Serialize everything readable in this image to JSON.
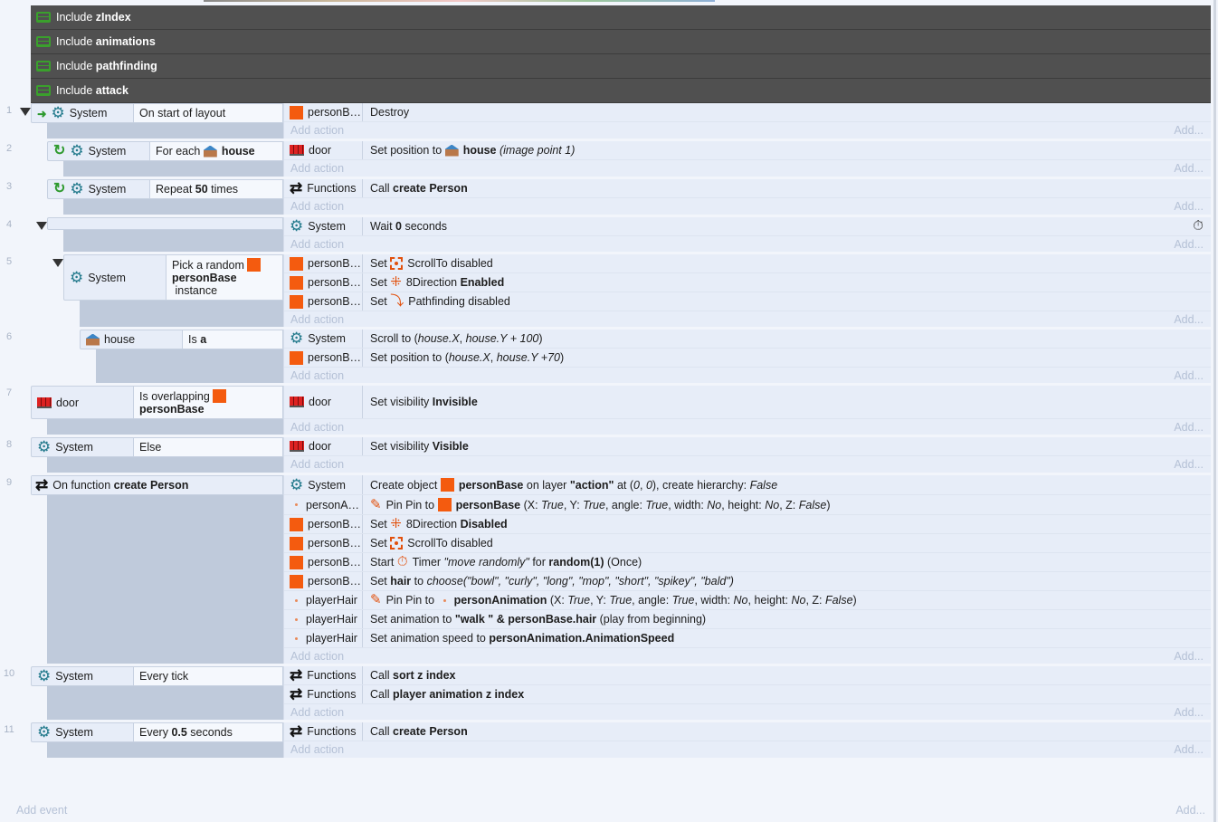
{
  "includes": [
    {
      "prefix": "Include ",
      "name": "zIndex"
    },
    {
      "prefix": "Include ",
      "name": "animations"
    },
    {
      "prefix": "Include ",
      "name": "pathfinding"
    },
    {
      "prefix": "Include ",
      "name": "attack"
    }
  ],
  "labels": {
    "add_action": "Add action",
    "add_more": "Add...",
    "add_event": "Add event"
  },
  "colors": {
    "object_orange": "#f45b0f",
    "system_teal": "#237a8c",
    "include_bg": "#505050",
    "event_bg": "#e7edf8",
    "filler": "#bfcadb"
  },
  "events": [
    {
      "num": "1",
      "indent": 0,
      "collapse": true,
      "conds": [
        {
          "pre": "arrow-icon",
          "icon": "gear-icon",
          "obj": "System",
          "text": [
            {
              "t": "On start of layout"
            }
          ]
        }
      ],
      "actions": [
        {
          "icon": "square-icon",
          "obj": "personB…",
          "text": [
            {
              "t": "Destroy"
            }
          ]
        }
      ]
    },
    {
      "num": "2",
      "indent": 1,
      "conds": [
        {
          "pre": "loop-icon",
          "icon": "gear-icon",
          "obj": "System",
          "text": [
            {
              "t": "For each "
            },
            {
              "icon": "house-icon"
            },
            {
              "t": "house",
              "b": true
            }
          ]
        }
      ],
      "actions": [
        {
          "icon": "door-icon",
          "obj": "door",
          "text": [
            {
              "t": "Set position to "
            },
            {
              "icon": "house-icon"
            },
            {
              "t": "house",
              "b": true
            },
            {
              "t": " (image point 1)",
              "i": true
            }
          ]
        }
      ]
    },
    {
      "num": "3",
      "indent": 1,
      "conds": [
        {
          "pre": "loop-icon",
          "icon": "gear-icon",
          "obj": "System",
          "text": [
            {
              "t": "Repeat "
            },
            {
              "t": "50",
              "b": true
            },
            {
              "t": " times"
            }
          ]
        }
      ],
      "actions": [
        {
          "icon": "functions-icon",
          "obj": "Functions",
          "text": [
            {
              "t": "Call "
            },
            {
              "t": "create Person",
              "b": true
            }
          ]
        }
      ]
    },
    {
      "num": "4",
      "indent": 1,
      "collapse": true,
      "conds": [],
      "actions": [
        {
          "icon": "gear-icon",
          "obj": "System",
          "text": [
            {
              "t": "Wait "
            },
            {
              "t": "0",
              "b": true
            },
            {
              "t": " seconds"
            }
          ],
          "trail": "timer-icon"
        }
      ]
    },
    {
      "num": "5",
      "indent": 2,
      "collapse": true,
      "conds": [
        {
          "icon": "gear-icon",
          "obj": "System",
          "text": [
            {
              "t": "Pick a random "
            },
            {
              "icon": "square-icon"
            },
            {
              "br": true
            },
            {
              "t": "personBase",
              "b": true
            },
            {
              "t": " instance"
            }
          ]
        }
      ],
      "actions": [
        {
          "icon": "square-icon",
          "obj": "personB…",
          "text": [
            {
              "t": "Set "
            },
            {
              "icon": "scrollto-icon"
            },
            {
              "t": "ScrollTo disabled"
            }
          ]
        },
        {
          "icon": "square-icon",
          "obj": "personB…",
          "text": [
            {
              "t": "Set "
            },
            {
              "icon": "8direction-icon"
            },
            {
              "t": "8Direction "
            },
            {
              "t": "Enabled",
              "b": true
            }
          ]
        },
        {
          "icon": "square-icon",
          "obj": "personB…",
          "text": [
            {
              "t": "Set "
            },
            {
              "icon": "pathfinding-icon"
            },
            {
              "t": "Pathfinding disabled"
            }
          ]
        }
      ]
    },
    {
      "num": "6",
      "indent": 3,
      "conds": [
        {
          "icon": "house-icon",
          "obj": "house",
          "text": [
            {
              "t": "Is "
            },
            {
              "t": "a",
              "b": true
            }
          ]
        }
      ],
      "actions": [
        {
          "icon": "gear-icon",
          "obj": "System",
          "text": [
            {
              "t": "Scroll to ("
            },
            {
              "t": "house.X",
              "i": true
            },
            {
              "t": ", "
            },
            {
              "t": "house.Y + 100",
              "i": true
            },
            {
              "t": ")"
            }
          ]
        },
        {
          "icon": "square-icon",
          "obj": "personB…",
          "text": [
            {
              "t": "Set position to ("
            },
            {
              "t": "house.X",
              "i": true
            },
            {
              "t": ", "
            },
            {
              "t": "house.Y +70",
              "i": true
            },
            {
              "t": ")"
            }
          ]
        }
      ]
    },
    {
      "num": "7",
      "indent": 0,
      "conds": [
        {
          "icon": "door-icon",
          "obj": "door",
          "text": [
            {
              "t": "Is overlapping "
            },
            {
              "icon": "square-icon"
            },
            {
              "br": true
            },
            {
              "t": "personBase",
              "b": true
            }
          ]
        }
      ],
      "actions": [
        {
          "icon": "door-icon",
          "obj": "door",
          "text": [
            {
              "t": "Set visibility "
            },
            {
              "t": "Invisible",
              "b": true
            }
          ]
        }
      ]
    },
    {
      "num": "8",
      "indent": 0,
      "conds": [
        {
          "icon": "gear-icon",
          "obj": "System",
          "text": [
            {
              "t": "Else"
            }
          ]
        }
      ],
      "actions": [
        {
          "icon": "door-icon",
          "obj": "door",
          "text": [
            {
              "t": "Set visibility "
            },
            {
              "t": "Visible",
              "b": true
            }
          ]
        }
      ]
    },
    {
      "num": "9",
      "indent": 0,
      "conds": [
        {
          "func": true,
          "pre": "functions-icon",
          "text": [
            {
              "t": "On function "
            },
            {
              "t": "create Person",
              "b": true
            }
          ]
        }
      ],
      "actions": [
        {
          "icon": "gear-icon",
          "obj": "System",
          "text": [
            {
              "t": "Create object "
            },
            {
              "icon": "square-icon"
            },
            {
              "t": "personBase",
              "b": true
            },
            {
              "t": " on layer "
            },
            {
              "t": "\"action\"",
              "b": true
            },
            {
              "t": " at ("
            },
            {
              "t": "0",
              "i": true
            },
            {
              "t": ", "
            },
            {
              "t": "0",
              "i": true
            },
            {
              "t": "), create hierarchy: "
            },
            {
              "t": "False",
              "i": true
            }
          ]
        },
        {
          "icon": "dot-icon",
          "obj": "personA…",
          "text": [
            {
              "icon": "pin-icon"
            },
            {
              "t": "Pin Pin to "
            },
            {
              "icon": "square-icon"
            },
            {
              "t": "personBase",
              "b": true
            },
            {
              "t": " (X: "
            },
            {
              "t": "True",
              "i": true
            },
            {
              "t": ", Y: "
            },
            {
              "t": "True",
              "i": true
            },
            {
              "t": ", angle: "
            },
            {
              "t": "True",
              "i": true
            },
            {
              "t": ", width: "
            },
            {
              "t": "No",
              "i": true
            },
            {
              "t": ", height: "
            },
            {
              "t": "No",
              "i": true
            },
            {
              "t": ", Z: "
            },
            {
              "t": "False",
              "i": true
            },
            {
              "t": ")"
            }
          ]
        },
        {
          "icon": "square-icon",
          "obj": "personB…",
          "text": [
            {
              "t": "Set "
            },
            {
              "icon": "8direction-icon"
            },
            {
              "t": "8Direction "
            },
            {
              "t": "Disabled",
              "b": true
            }
          ]
        },
        {
          "icon": "square-icon",
          "obj": "personB…",
          "text": [
            {
              "t": "Set "
            },
            {
              "icon": "scrollto-icon"
            },
            {
              "t": "ScrollTo disabled"
            }
          ]
        },
        {
          "icon": "square-icon",
          "obj": "personB…",
          "text": [
            {
              "t": "Start "
            },
            {
              "icon": "timer-icon"
            },
            {
              "t": "Timer "
            },
            {
              "t": "\"move randomly\"",
              "i": true
            },
            {
              "t": " for "
            },
            {
              "t": "random(1)",
              "b": true
            },
            {
              "t": " (Once)"
            }
          ]
        },
        {
          "icon": "square-icon",
          "obj": "personB…",
          "text": [
            {
              "t": "Set "
            },
            {
              "t": "hair",
              "b": true
            },
            {
              "t": " to "
            },
            {
              "t": "choose(\"bowl\", \"curly\", \"long\", \"mop\", \"short\", \"spikey\", \"bald\")",
              "i": true
            }
          ]
        },
        {
          "icon": "dot-icon",
          "obj": "playerHair",
          "text": [
            {
              "icon": "pin-icon"
            },
            {
              "t": "Pin Pin to "
            },
            {
              "icon": "dot-icon"
            },
            {
              "t": "personAnimation",
              "b": true
            },
            {
              "t": " (X: "
            },
            {
              "t": "True",
              "i": true
            },
            {
              "t": ", Y: "
            },
            {
              "t": "True",
              "i": true
            },
            {
              "t": ", angle: "
            },
            {
              "t": "True",
              "i": true
            },
            {
              "t": ", width: "
            },
            {
              "t": "No",
              "i": true
            },
            {
              "t": ", height: "
            },
            {
              "t": "No",
              "i": true
            },
            {
              "t": ", Z: "
            },
            {
              "t": "False",
              "i": true
            },
            {
              "t": ")"
            }
          ]
        },
        {
          "icon": "dot-icon",
          "obj": "playerHair",
          "text": [
            {
              "t": "Set animation to "
            },
            {
              "t": "\"walk \" & personBase.hair",
              "b": true
            },
            {
              "t": " (play from beginning)"
            }
          ]
        },
        {
          "icon": "dot-icon",
          "obj": "playerHair",
          "text": [
            {
              "t": "Set animation speed to "
            },
            {
              "t": "personAnimation.AnimationSpeed",
              "b": true
            }
          ]
        }
      ]
    },
    {
      "num": "10",
      "indent": 0,
      "conds": [
        {
          "icon": "gear-icon",
          "obj": "System",
          "text": [
            {
              "t": "Every tick"
            }
          ]
        }
      ],
      "actions": [
        {
          "icon": "functions-icon",
          "obj": "Functions",
          "text": [
            {
              "t": "Call "
            },
            {
              "t": "sort z index",
              "b": true
            }
          ]
        },
        {
          "icon": "functions-icon",
          "obj": "Functions",
          "text": [
            {
              "t": "Call "
            },
            {
              "t": "player animation z index",
              "b": true
            }
          ]
        }
      ]
    },
    {
      "num": "11",
      "indent": 0,
      "conds": [
        {
          "icon": "gear-icon",
          "obj": "System",
          "text": [
            {
              "t": "Every "
            },
            {
              "t": "0.5",
              "b": true
            },
            {
              "t": " seconds"
            }
          ]
        }
      ],
      "actions": [
        {
          "icon": "functions-icon",
          "obj": "Functions",
          "text": [
            {
              "t": "Call "
            },
            {
              "t": "create Person",
              "b": true
            }
          ]
        }
      ]
    }
  ]
}
